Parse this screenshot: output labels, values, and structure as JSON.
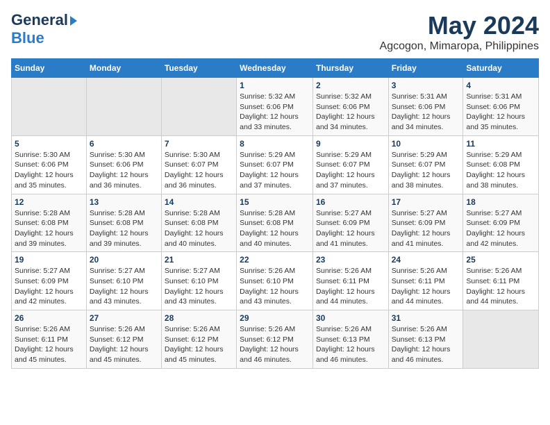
{
  "header": {
    "logo_line1": "General",
    "logo_line2": "Blue",
    "title": "May 2024",
    "subtitle": "Agcogon, Mimaropa, Philippines"
  },
  "calendar": {
    "days_of_week": [
      "Sunday",
      "Monday",
      "Tuesday",
      "Wednesday",
      "Thursday",
      "Friday",
      "Saturday"
    ],
    "weeks": [
      [
        {
          "day": "",
          "info": ""
        },
        {
          "day": "",
          "info": ""
        },
        {
          "day": "",
          "info": ""
        },
        {
          "day": "1",
          "info": "Sunrise: 5:32 AM\nSunset: 6:06 PM\nDaylight: 12 hours and 33 minutes."
        },
        {
          "day": "2",
          "info": "Sunrise: 5:32 AM\nSunset: 6:06 PM\nDaylight: 12 hours and 34 minutes."
        },
        {
          "day": "3",
          "info": "Sunrise: 5:31 AM\nSunset: 6:06 PM\nDaylight: 12 hours and 34 minutes."
        },
        {
          "day": "4",
          "info": "Sunrise: 5:31 AM\nSunset: 6:06 PM\nDaylight: 12 hours and 35 minutes."
        }
      ],
      [
        {
          "day": "5",
          "info": "Sunrise: 5:30 AM\nSunset: 6:06 PM\nDaylight: 12 hours and 35 minutes."
        },
        {
          "day": "6",
          "info": "Sunrise: 5:30 AM\nSunset: 6:06 PM\nDaylight: 12 hours and 36 minutes."
        },
        {
          "day": "7",
          "info": "Sunrise: 5:30 AM\nSunset: 6:07 PM\nDaylight: 12 hours and 36 minutes."
        },
        {
          "day": "8",
          "info": "Sunrise: 5:29 AM\nSunset: 6:07 PM\nDaylight: 12 hours and 37 minutes."
        },
        {
          "day": "9",
          "info": "Sunrise: 5:29 AM\nSunset: 6:07 PM\nDaylight: 12 hours and 37 minutes."
        },
        {
          "day": "10",
          "info": "Sunrise: 5:29 AM\nSunset: 6:07 PM\nDaylight: 12 hours and 38 minutes."
        },
        {
          "day": "11",
          "info": "Sunrise: 5:29 AM\nSunset: 6:08 PM\nDaylight: 12 hours and 38 minutes."
        }
      ],
      [
        {
          "day": "12",
          "info": "Sunrise: 5:28 AM\nSunset: 6:08 PM\nDaylight: 12 hours and 39 minutes."
        },
        {
          "day": "13",
          "info": "Sunrise: 5:28 AM\nSunset: 6:08 PM\nDaylight: 12 hours and 39 minutes."
        },
        {
          "day": "14",
          "info": "Sunrise: 5:28 AM\nSunset: 6:08 PM\nDaylight: 12 hours and 40 minutes."
        },
        {
          "day": "15",
          "info": "Sunrise: 5:28 AM\nSunset: 6:08 PM\nDaylight: 12 hours and 40 minutes."
        },
        {
          "day": "16",
          "info": "Sunrise: 5:27 AM\nSunset: 6:09 PM\nDaylight: 12 hours and 41 minutes."
        },
        {
          "day": "17",
          "info": "Sunrise: 5:27 AM\nSunset: 6:09 PM\nDaylight: 12 hours and 41 minutes."
        },
        {
          "day": "18",
          "info": "Sunrise: 5:27 AM\nSunset: 6:09 PM\nDaylight: 12 hours and 42 minutes."
        }
      ],
      [
        {
          "day": "19",
          "info": "Sunrise: 5:27 AM\nSunset: 6:09 PM\nDaylight: 12 hours and 42 minutes."
        },
        {
          "day": "20",
          "info": "Sunrise: 5:27 AM\nSunset: 6:10 PM\nDaylight: 12 hours and 43 minutes."
        },
        {
          "day": "21",
          "info": "Sunrise: 5:27 AM\nSunset: 6:10 PM\nDaylight: 12 hours and 43 minutes."
        },
        {
          "day": "22",
          "info": "Sunrise: 5:26 AM\nSunset: 6:10 PM\nDaylight: 12 hours and 43 minutes."
        },
        {
          "day": "23",
          "info": "Sunrise: 5:26 AM\nSunset: 6:11 PM\nDaylight: 12 hours and 44 minutes."
        },
        {
          "day": "24",
          "info": "Sunrise: 5:26 AM\nSunset: 6:11 PM\nDaylight: 12 hours and 44 minutes."
        },
        {
          "day": "25",
          "info": "Sunrise: 5:26 AM\nSunset: 6:11 PM\nDaylight: 12 hours and 44 minutes."
        }
      ],
      [
        {
          "day": "26",
          "info": "Sunrise: 5:26 AM\nSunset: 6:11 PM\nDaylight: 12 hours and 45 minutes."
        },
        {
          "day": "27",
          "info": "Sunrise: 5:26 AM\nSunset: 6:12 PM\nDaylight: 12 hours and 45 minutes."
        },
        {
          "day": "28",
          "info": "Sunrise: 5:26 AM\nSunset: 6:12 PM\nDaylight: 12 hours and 45 minutes."
        },
        {
          "day": "29",
          "info": "Sunrise: 5:26 AM\nSunset: 6:12 PM\nDaylight: 12 hours and 46 minutes."
        },
        {
          "day": "30",
          "info": "Sunrise: 5:26 AM\nSunset: 6:13 PM\nDaylight: 12 hours and 46 minutes."
        },
        {
          "day": "31",
          "info": "Sunrise: 5:26 AM\nSunset: 6:13 PM\nDaylight: 12 hours and 46 minutes."
        },
        {
          "day": "",
          "info": ""
        }
      ]
    ]
  }
}
